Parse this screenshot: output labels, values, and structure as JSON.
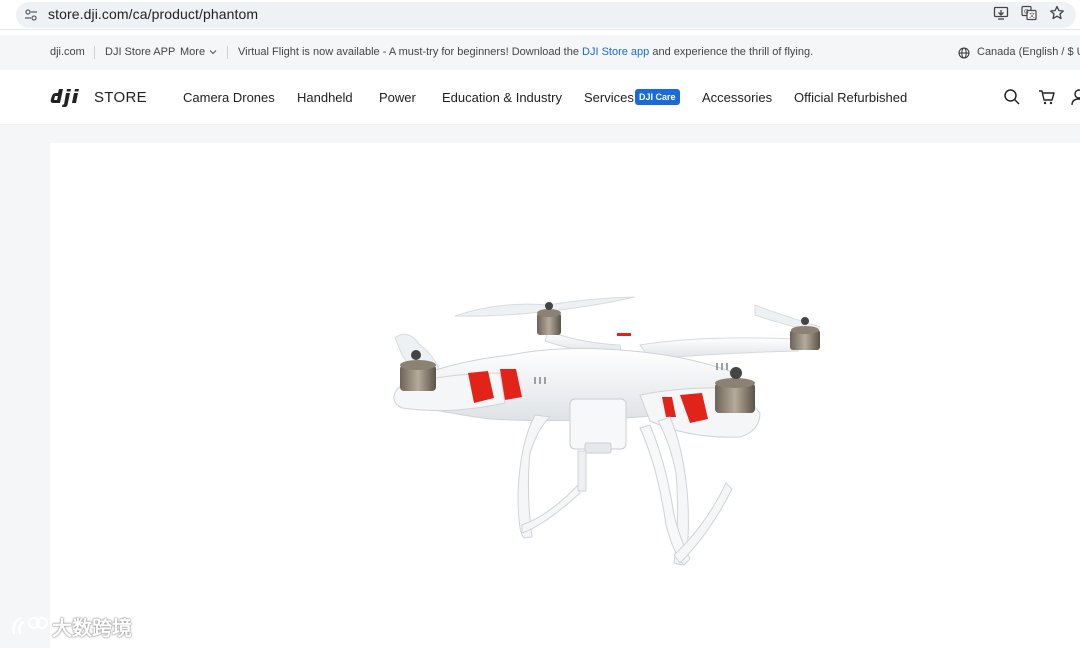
{
  "browser": {
    "url": "store.dji.com/ca/product/phantom"
  },
  "top_strip": {
    "links": [
      "dji.com",
      "DJI Store APP",
      "More"
    ],
    "promo_prefix": "Virtual Flight is now available - A must-try for beginners! Download the ",
    "promo_link": "DJI Store app",
    "promo_suffix": " and experience the thrill of flying.",
    "region": "Canada (English / $ US"
  },
  "nav": {
    "store_label": "STORE",
    "items": [
      "Camera Drones",
      "Handheld",
      "Power",
      "Education & Industry",
      "Services",
      "Accessories",
      "Official Refurbished"
    ],
    "care_badge": "DJI Care"
  },
  "watermark": {
    "text": "大数跨境"
  },
  "colors": {
    "accent": "#1a6bd9",
    "drone_stripe": "#e2231a"
  }
}
